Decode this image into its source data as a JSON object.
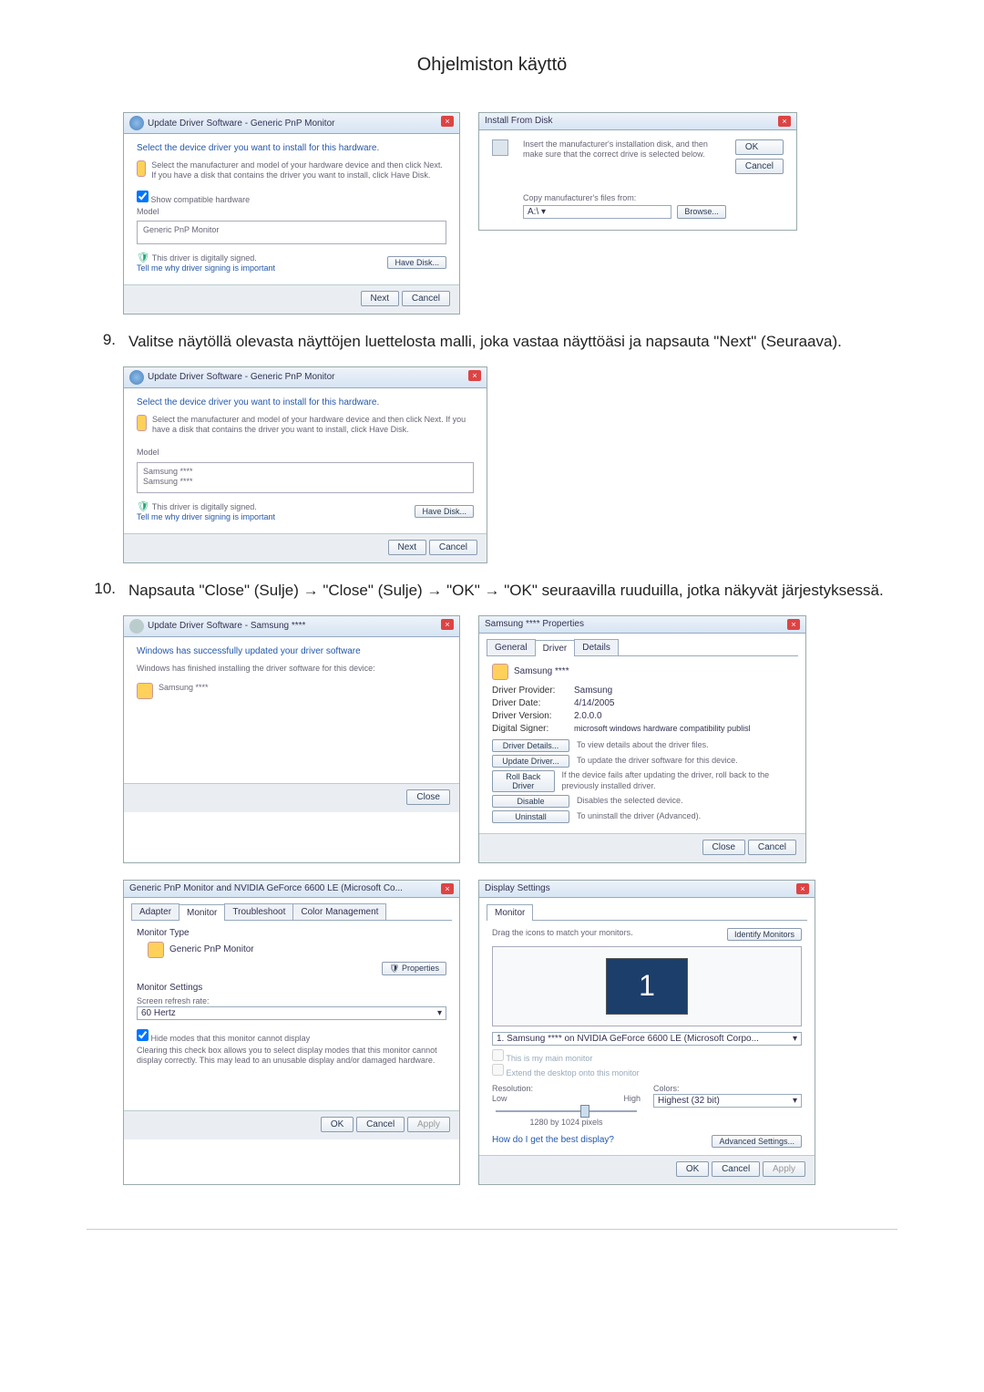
{
  "page_title": "Ohjelmiston käyttö",
  "step9": {
    "num": "9.",
    "text": "Valitse näytöllä olevasta näyttöjen luettelosta malli, joka vastaa näyttöäsi ja napsauta \"Next\" (Seuraava)."
  },
  "step10": {
    "num": "10.",
    "text": "Napsauta \"Close\" (Sulje) → \"Close\" (Sulje) → \"OK\" → \"OK\" seuraavilla ruuduilla, jotka näkyvät järjestyksessä."
  },
  "win_update1": {
    "title": "Update Driver Software - Generic PnP Monitor",
    "heading": "Select the device driver you want to install for this hardware.",
    "instr": "Select the manufacturer and model of your hardware device and then click Next. If you have a disk that contains the driver you want to install, click Have Disk.",
    "compat_chk": "Show compatible hardware",
    "model_hdr": "Model",
    "model_item": "Generic PnP Monitor",
    "signed": "This driver is digitally signed.",
    "signed_link": "Tell me why driver signing is important",
    "have_disk": "Have Disk...",
    "next": "Next",
    "cancel": "Cancel"
  },
  "win_install_disk": {
    "title": "Install From Disk",
    "instr": "Insert the manufacturer's installation disk, and then make sure that the correct drive is selected below.",
    "copy_label": "Copy manufacturer's files from:",
    "drive": "A:\\",
    "ok": "OK",
    "cancel": "Cancel",
    "browse": "Browse..."
  },
  "win_update2": {
    "title": "Update Driver Software - Generic PnP Monitor",
    "heading": "Select the device driver you want to install for this hardware.",
    "instr": "Select the manufacturer and model of your hardware device and then click Next. If you have a disk that contains the driver you want to install, click Have Disk.",
    "model_hdr": "Model",
    "model1": "Samsung ****",
    "model2": "Samsung ****",
    "signed": "This driver is digitally signed.",
    "signed_link": "Tell me why driver signing is important",
    "have_disk": "Have Disk...",
    "next": "Next",
    "cancel": "Cancel"
  },
  "win_success": {
    "title": "Update Driver Software - Samsung ****",
    "heading": "Windows has successfully updated your driver software",
    "sub": "Windows has finished installing the driver software for this device:",
    "device": "Samsung ****",
    "close": "Close"
  },
  "win_prop": {
    "title": "Samsung **** Properties",
    "tab_general": "General",
    "tab_driver": "Driver",
    "tab_details": "Details",
    "device": "Samsung ****",
    "rows": {
      "provider_l": "Driver Provider:",
      "provider_v": "Samsung",
      "date_l": "Driver Date:",
      "date_v": "4/14/2005",
      "ver_l": "Driver Version:",
      "ver_v": "2.0.0.0",
      "sig_l": "Digital Signer:",
      "sig_v": "microsoft windows hardware compatibility publisl"
    },
    "btn_details": "Driver Details...",
    "txt_details": "To view details about the driver files.",
    "btn_update": "Update Driver...",
    "txt_update": "To update the driver software for this device.",
    "btn_roll": "Roll Back Driver",
    "txt_roll": "If the device fails after updating the driver, roll back to the previously installed driver.",
    "btn_disable": "Disable",
    "txt_disable": "Disables the selected device.",
    "btn_uninst": "Uninstall",
    "txt_uninst": "To uninstall the driver (Advanced).",
    "close": "Close",
    "cancel": "Cancel"
  },
  "win_monitor": {
    "title": "Generic PnP Monitor and NVIDIA GeForce 6600 LE (Microsoft Co...",
    "tab_adapter": "Adapter",
    "tab_monitor": "Monitor",
    "tab_trouble": "Troubleshoot",
    "tab_color": "Color Management",
    "type_hdr": "Monitor Type",
    "type_val": "Generic PnP Monitor",
    "properties": "Properties",
    "settings_hdr": "Monitor Settings",
    "refresh_l": "Screen refresh rate:",
    "refresh_v": "60 Hertz",
    "hide_chk": "Hide modes that this monitor cannot display",
    "hide_txt": "Clearing this check box allows you to select display modes that this monitor cannot display correctly. This may lead to an unusable display and/or damaged hardware.",
    "ok": "OK",
    "cancel": "Cancel",
    "apply": "Apply"
  },
  "win_display": {
    "title": "Display Settings",
    "tab_monitor": "Monitor",
    "drag": "Drag the icons to match your monitors.",
    "identify": "Identify Monitors",
    "mon_num": "1",
    "device": "1. Samsung **** on NVIDIA GeForce 6600 LE (Microsoft Corpo...",
    "main_chk": "This is my main monitor",
    "extend_chk": "Extend the desktop onto this monitor",
    "res_hdr": "Resolution:",
    "low": "Low",
    "high": "High",
    "res_val": "1280 by 1024 pixels",
    "colors_hdr": "Colors:",
    "colors_val": "Highest (32 bit)",
    "help_link": "How do I get the best display?",
    "advanced": "Advanced Settings...",
    "ok": "OK",
    "cancel": "Cancel",
    "apply": "Apply"
  }
}
